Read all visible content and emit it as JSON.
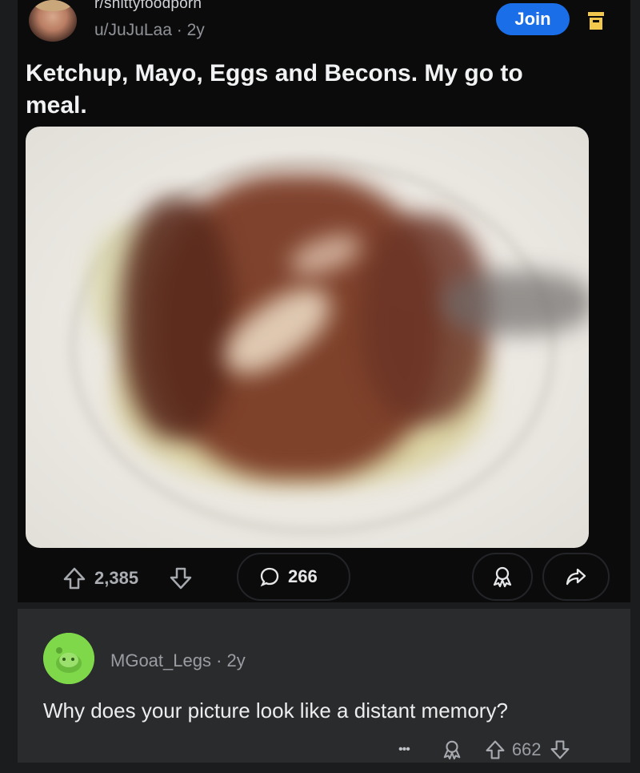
{
  "post": {
    "subreddit": "r/shittyfoodporn",
    "user": "u/JuJuLaa",
    "age": "2y",
    "join_label": "Join",
    "title": "Ketchup, Mayo, Eggs and Becons. My go to meal."
  },
  "actions": {
    "upvotes": "2,385",
    "comments": "266"
  },
  "comment": {
    "user": "MGoat_Legs",
    "age": "2y",
    "text": "Why does your picture look like a distant memory?",
    "more_label": "•••",
    "upvotes": "662"
  },
  "colors": {
    "accent_blue": "#1a6ee8",
    "save_yellow": "#f2c94c",
    "snoo_green": "#7fd84a"
  },
  "icons": {
    "upvote": "arrow-up-icon",
    "downvote": "arrow-down-icon",
    "comment": "speech-bubble-icon",
    "award": "award-icon",
    "share": "share-icon",
    "save": "save-icon"
  }
}
